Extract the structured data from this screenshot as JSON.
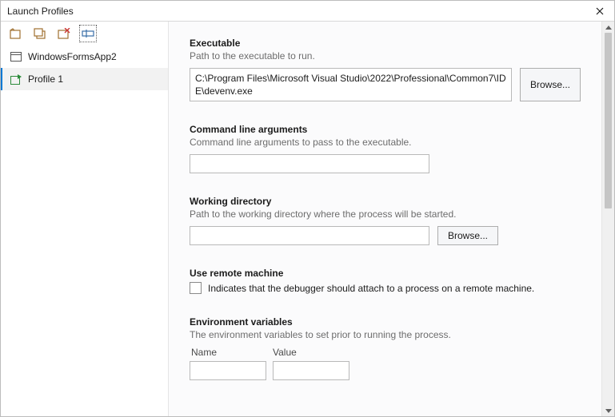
{
  "window": {
    "title": "Launch Profiles"
  },
  "sidebar": {
    "profiles": [
      {
        "label": "WindowsFormsApp2",
        "selected": false,
        "icon": "window"
      },
      {
        "label": "Profile 1",
        "selected": true,
        "icon": "exe"
      }
    ]
  },
  "form": {
    "executable": {
      "heading": "Executable",
      "desc": "Path to the executable to run.",
      "value": "C:\\Program Files\\Microsoft Visual Studio\\2022\\Professional\\Common7\\IDE\\devenv.exe",
      "browse": "Browse..."
    },
    "args": {
      "heading": "Command line arguments",
      "desc": "Command line arguments to pass to the executable.",
      "value": ""
    },
    "workdir": {
      "heading": "Working directory",
      "desc": "Path to the working directory where the process will be started.",
      "value": "",
      "browse": "Browse..."
    },
    "remote": {
      "heading": "Use remote machine",
      "label": "Indicates that the debugger should attach to a process on a remote machine."
    },
    "env": {
      "heading": "Environment variables",
      "desc": "The environment variables to set prior to running the process.",
      "colName": "Name",
      "colValue": "Value"
    }
  }
}
